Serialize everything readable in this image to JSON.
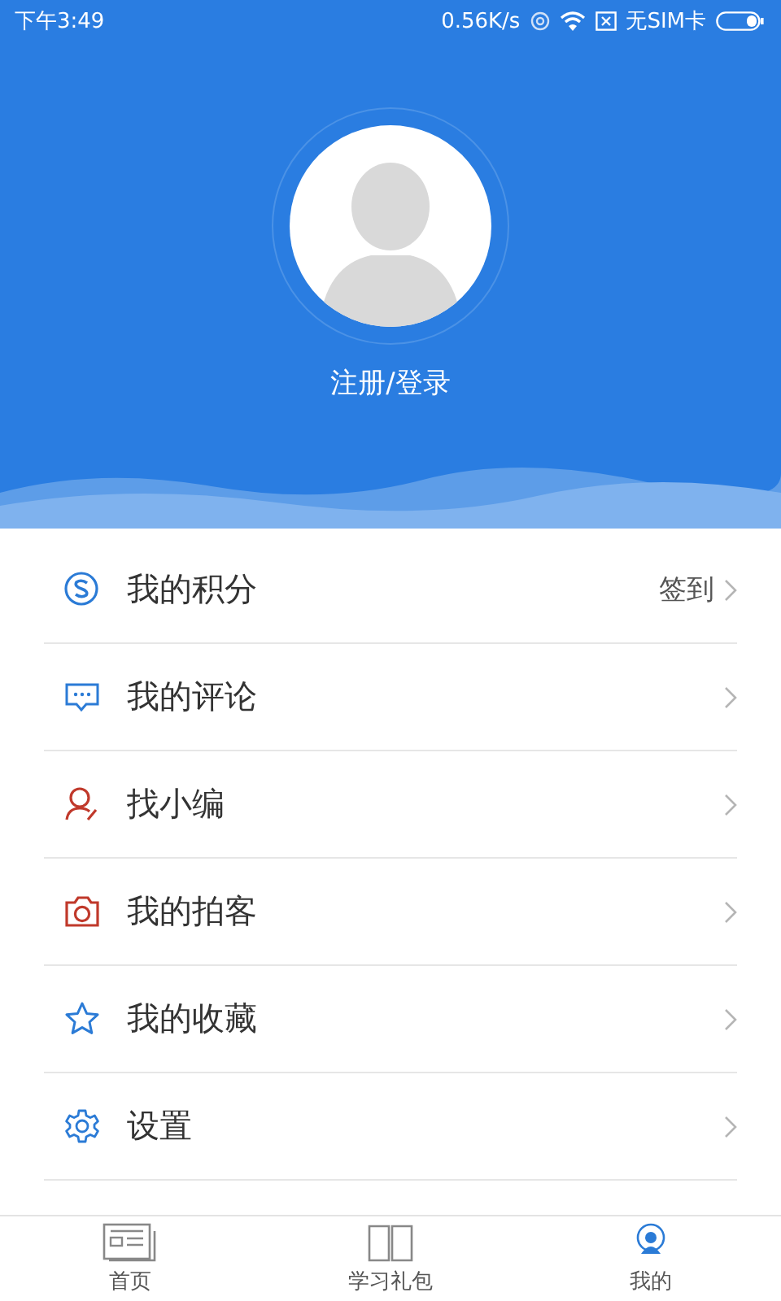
{
  "status_bar": {
    "time": "下午3:49",
    "speed": "0.56K/s",
    "sim": "无SIM卡"
  },
  "profile": {
    "login": "注册/登录"
  },
  "menu": [
    {
      "label": "我的积分",
      "action": "签到"
    },
    {
      "label": "我的评论"
    },
    {
      "label": "找小编"
    },
    {
      "label": "我的拍客"
    },
    {
      "label": "我的收藏"
    },
    {
      "label": "设置"
    }
  ],
  "tabs": [
    {
      "label": "首页"
    },
    {
      "label": "学习礼包"
    },
    {
      "label": "我的"
    }
  ]
}
